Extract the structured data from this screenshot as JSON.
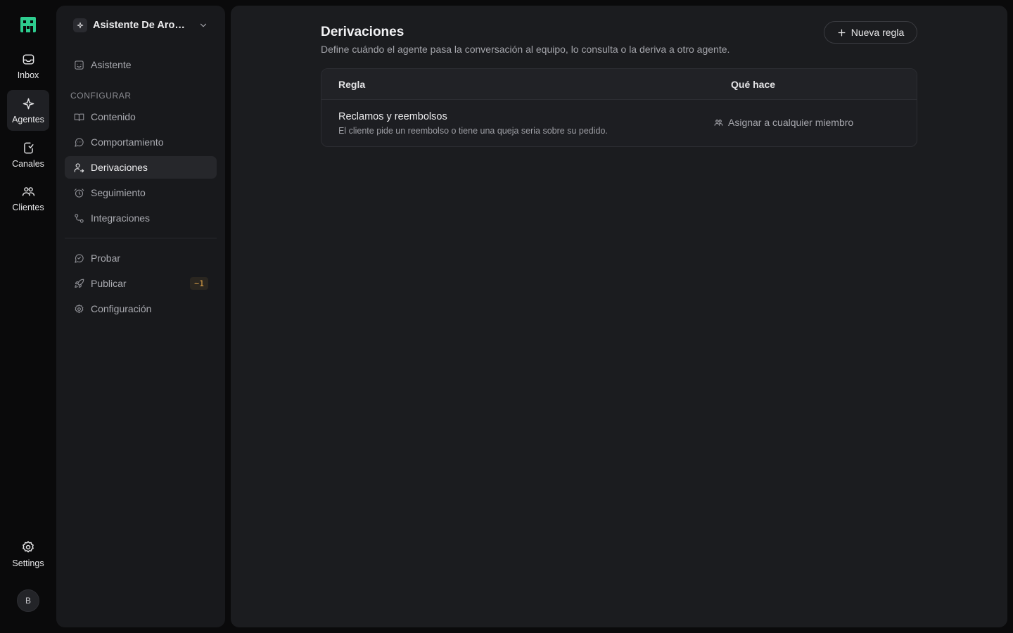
{
  "colors": {
    "brand": "#2ecc8f",
    "background": "#0a0a0b",
    "sidebar_bg": "#18191c",
    "main_bg": "#1b1c1f",
    "badge_text": "#e0a44a"
  },
  "rail": {
    "logo_icon": "brand-logo-icon",
    "items": [
      {
        "label": "Inbox",
        "icon": "inbox-icon"
      },
      {
        "label": "Agentes",
        "icon": "sparkle-icon",
        "active": true
      },
      {
        "label": "Canales",
        "icon": "channel-icon"
      },
      {
        "label": "Clientes",
        "icon": "users-icon"
      }
    ],
    "settings_label": "Settings",
    "avatar_initial": "B"
  },
  "sidebar": {
    "agent_name": "Asistente De Aromas Naturales",
    "top_item": {
      "label": "Asistente",
      "icon": "assistant-icon"
    },
    "section_label": "CONFIGURAR",
    "config_items": [
      {
        "label": "Contenido",
        "icon": "book-icon"
      },
      {
        "label": "Comportamiento",
        "icon": "chat-icon"
      },
      {
        "label": "Derivaciones",
        "icon": "handoff-icon",
        "active": true
      },
      {
        "label": "Seguimiento",
        "icon": "clock-icon"
      },
      {
        "label": "Integraciones",
        "icon": "integration-icon"
      }
    ],
    "bottom_items": [
      {
        "label": "Probar",
        "icon": "test-icon"
      },
      {
        "label": "Publicar",
        "icon": "rocket-icon",
        "badge": "~1"
      },
      {
        "label": "Configuración",
        "icon": "gear-icon"
      }
    ]
  },
  "main": {
    "title": "Derivaciones",
    "subtitle": "Define cuándo el agente pasa la conversación al equipo, lo consulta o la deriva a otro agente.",
    "new_rule_label": "Nueva regla",
    "table": {
      "columns": [
        "Regla",
        "Qué hace"
      ],
      "rows": [
        {
          "title": "Reclamos y reembolsos",
          "description": "El cliente pide un reembolso o tiene una queja seria sobre su pedido.",
          "action": "Asignar a cualquier miembro",
          "action_icon": "team-icon"
        }
      ]
    }
  }
}
